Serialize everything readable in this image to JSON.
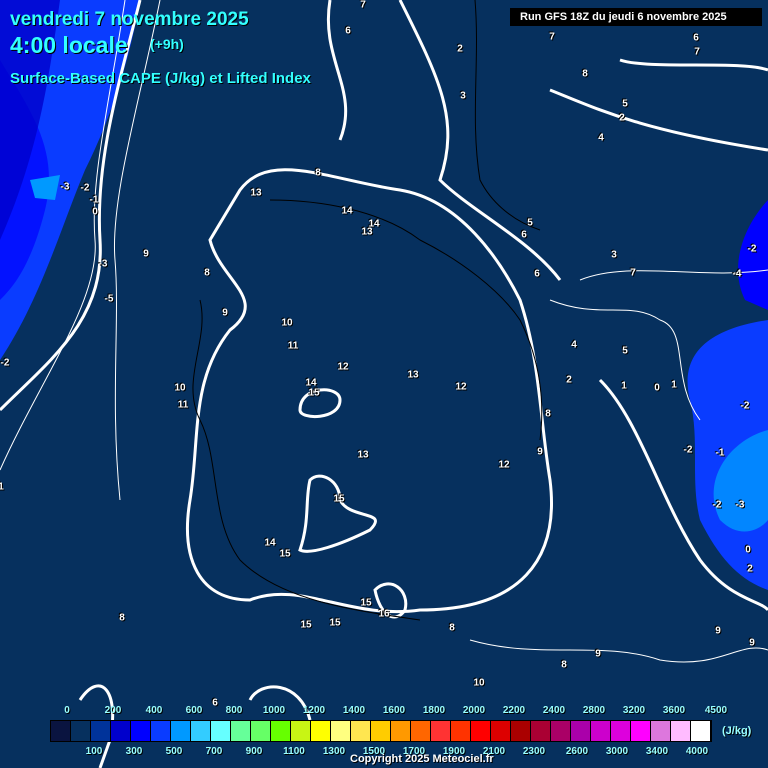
{
  "header": {
    "date": "vendredi 7 novembre 2025",
    "time": "4:00 locale",
    "offset": "(+9h)",
    "parameter": "Surface-Based CAPE (J/kg) et Lifted Index",
    "run": "Run GFS 18Z du jeudi 6 novembre 2025"
  },
  "legend": {
    "unit": "(J/kg)",
    "top_labels": [
      "0",
      "200",
      "400",
      "600",
      "800",
      "1000",
      "1200",
      "1400",
      "1600",
      "1800",
      "2000",
      "2200",
      "2400",
      "2800",
      "3200",
      "3600",
      "4500"
    ],
    "bottom_labels": [
      "100",
      "300",
      "500",
      "700",
      "900",
      "1100",
      "1300",
      "1500",
      "1700",
      "1900",
      "2100",
      "2300",
      "2600",
      "3000",
      "3400",
      "4000"
    ],
    "colors": [
      "#0a1440",
      "#06305e",
      "#00339a",
      "#0000cc",
      "#0000ff",
      "#0a3cff",
      "#0099ff",
      "#33ccff",
      "#66ffff",
      "#66ff99",
      "#66ff66",
      "#66ff00",
      "#c8f514",
      "#ffff00",
      "#ffff80",
      "#ffe650",
      "#ffcc00",
      "#ff9900",
      "#ff6600",
      "#ff3333",
      "#ff3300",
      "#ff0000",
      "#dd0000",
      "#aa0000",
      "#aa0033",
      "#aa0066",
      "#aa00aa",
      "#cc00cc",
      "#dd00dd",
      "#ff00ff",
      "#dd77dd",
      "#ffbbff",
      "#ffffff"
    ]
  },
  "lifted_index_labels": [
    "7",
    "6",
    "2",
    "3",
    "7",
    "8",
    "7",
    "6",
    "5",
    "4",
    "2",
    "5",
    "8",
    "13",
    "14",
    "14",
    "13",
    "9",
    "8",
    "9",
    "10",
    "11",
    "12",
    "13",
    "12",
    "14",
    "15",
    "10",
    "11",
    "13",
    "12",
    "15",
    "14",
    "15",
    "15",
    "16",
    "15",
    "15",
    "8",
    "8",
    "9",
    "9",
    "9",
    "8",
    "10",
    "6",
    "4",
    "5",
    "6",
    "6",
    "3",
    "7",
    "2",
    "1",
    "0",
    "8",
    "9",
    "-2",
    "-4",
    "-2",
    "-2",
    "-1",
    "-2",
    "-3",
    "0",
    "2",
    "-3",
    "-2",
    "-1",
    "0",
    "1",
    "-3",
    "-5",
    "-2",
    "1"
  ],
  "copyright": "Copyright 2025 Meteociel.fr"
}
